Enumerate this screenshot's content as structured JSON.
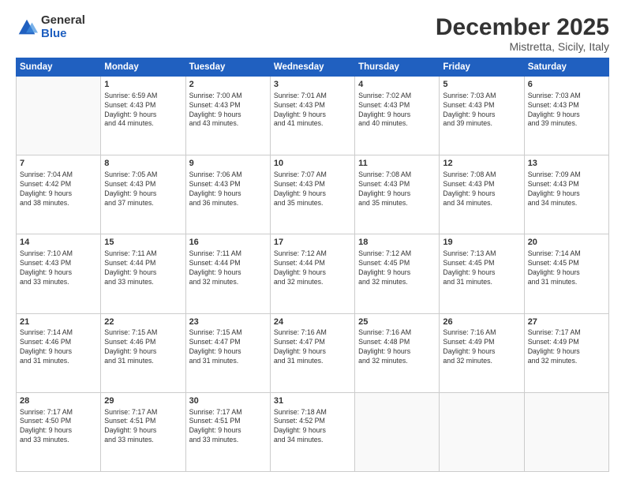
{
  "logo": {
    "general": "General",
    "blue": "Blue"
  },
  "title": "December 2025",
  "subtitle": "Mistretta, Sicily, Italy",
  "weekdays": [
    "Sunday",
    "Monday",
    "Tuesday",
    "Wednesday",
    "Thursday",
    "Friday",
    "Saturday"
  ],
  "weeks": [
    [
      {
        "day": "",
        "info": ""
      },
      {
        "day": "1",
        "info": "Sunrise: 6:59 AM\nSunset: 4:43 PM\nDaylight: 9 hours\nand 44 minutes."
      },
      {
        "day": "2",
        "info": "Sunrise: 7:00 AM\nSunset: 4:43 PM\nDaylight: 9 hours\nand 43 minutes."
      },
      {
        "day": "3",
        "info": "Sunrise: 7:01 AM\nSunset: 4:43 PM\nDaylight: 9 hours\nand 41 minutes."
      },
      {
        "day": "4",
        "info": "Sunrise: 7:02 AM\nSunset: 4:43 PM\nDaylight: 9 hours\nand 40 minutes."
      },
      {
        "day": "5",
        "info": "Sunrise: 7:03 AM\nSunset: 4:43 PM\nDaylight: 9 hours\nand 39 minutes."
      },
      {
        "day": "6",
        "info": "Sunrise: 7:03 AM\nSunset: 4:43 PM\nDaylight: 9 hours\nand 39 minutes."
      }
    ],
    [
      {
        "day": "7",
        "info": "Sunrise: 7:04 AM\nSunset: 4:42 PM\nDaylight: 9 hours\nand 38 minutes."
      },
      {
        "day": "8",
        "info": "Sunrise: 7:05 AM\nSunset: 4:43 PM\nDaylight: 9 hours\nand 37 minutes."
      },
      {
        "day": "9",
        "info": "Sunrise: 7:06 AM\nSunset: 4:43 PM\nDaylight: 9 hours\nand 36 minutes."
      },
      {
        "day": "10",
        "info": "Sunrise: 7:07 AM\nSunset: 4:43 PM\nDaylight: 9 hours\nand 35 minutes."
      },
      {
        "day": "11",
        "info": "Sunrise: 7:08 AM\nSunset: 4:43 PM\nDaylight: 9 hours\nand 35 minutes."
      },
      {
        "day": "12",
        "info": "Sunrise: 7:08 AM\nSunset: 4:43 PM\nDaylight: 9 hours\nand 34 minutes."
      },
      {
        "day": "13",
        "info": "Sunrise: 7:09 AM\nSunset: 4:43 PM\nDaylight: 9 hours\nand 34 minutes."
      }
    ],
    [
      {
        "day": "14",
        "info": "Sunrise: 7:10 AM\nSunset: 4:43 PM\nDaylight: 9 hours\nand 33 minutes."
      },
      {
        "day": "15",
        "info": "Sunrise: 7:11 AM\nSunset: 4:44 PM\nDaylight: 9 hours\nand 33 minutes."
      },
      {
        "day": "16",
        "info": "Sunrise: 7:11 AM\nSunset: 4:44 PM\nDaylight: 9 hours\nand 32 minutes."
      },
      {
        "day": "17",
        "info": "Sunrise: 7:12 AM\nSunset: 4:44 PM\nDaylight: 9 hours\nand 32 minutes."
      },
      {
        "day": "18",
        "info": "Sunrise: 7:12 AM\nSunset: 4:45 PM\nDaylight: 9 hours\nand 32 minutes."
      },
      {
        "day": "19",
        "info": "Sunrise: 7:13 AM\nSunset: 4:45 PM\nDaylight: 9 hours\nand 31 minutes."
      },
      {
        "day": "20",
        "info": "Sunrise: 7:14 AM\nSunset: 4:45 PM\nDaylight: 9 hours\nand 31 minutes."
      }
    ],
    [
      {
        "day": "21",
        "info": "Sunrise: 7:14 AM\nSunset: 4:46 PM\nDaylight: 9 hours\nand 31 minutes."
      },
      {
        "day": "22",
        "info": "Sunrise: 7:15 AM\nSunset: 4:46 PM\nDaylight: 9 hours\nand 31 minutes."
      },
      {
        "day": "23",
        "info": "Sunrise: 7:15 AM\nSunset: 4:47 PM\nDaylight: 9 hours\nand 31 minutes."
      },
      {
        "day": "24",
        "info": "Sunrise: 7:16 AM\nSunset: 4:47 PM\nDaylight: 9 hours\nand 31 minutes."
      },
      {
        "day": "25",
        "info": "Sunrise: 7:16 AM\nSunset: 4:48 PM\nDaylight: 9 hours\nand 32 minutes."
      },
      {
        "day": "26",
        "info": "Sunrise: 7:16 AM\nSunset: 4:49 PM\nDaylight: 9 hours\nand 32 minutes."
      },
      {
        "day": "27",
        "info": "Sunrise: 7:17 AM\nSunset: 4:49 PM\nDaylight: 9 hours\nand 32 minutes."
      }
    ],
    [
      {
        "day": "28",
        "info": "Sunrise: 7:17 AM\nSunset: 4:50 PM\nDaylight: 9 hours\nand 33 minutes."
      },
      {
        "day": "29",
        "info": "Sunrise: 7:17 AM\nSunset: 4:51 PM\nDaylight: 9 hours\nand 33 minutes."
      },
      {
        "day": "30",
        "info": "Sunrise: 7:17 AM\nSunset: 4:51 PM\nDaylight: 9 hours\nand 33 minutes."
      },
      {
        "day": "31",
        "info": "Sunrise: 7:18 AM\nSunset: 4:52 PM\nDaylight: 9 hours\nand 34 minutes."
      },
      {
        "day": "",
        "info": ""
      },
      {
        "day": "",
        "info": ""
      },
      {
        "day": "",
        "info": ""
      }
    ]
  ]
}
